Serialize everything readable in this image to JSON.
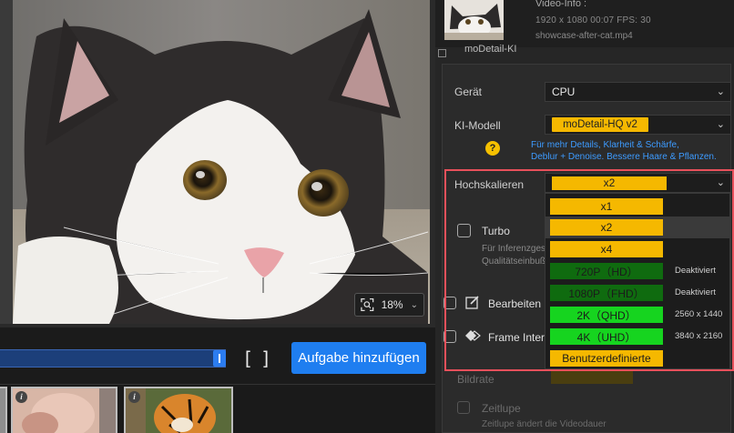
{
  "preview": {
    "zoom_value": "18%"
  },
  "timeline": {
    "bracket_in": "[",
    "bracket_out": "]",
    "add_task_label": "Aufgabe hinzufügen"
  },
  "thumbnails": [
    {
      "info": "i"
    },
    {
      "info": "i"
    }
  ],
  "video_info": {
    "title": "Video-Info :",
    "meta": "1920 x 1080  00:07  FPS: 30",
    "file": "showcase-after-cat.mp4"
  },
  "ai_section": {
    "title": "moDetail-KI",
    "device_label": "Gerät",
    "device_value": "CPU",
    "model_label": "KI-Modell",
    "model_value": "moDetail-HQ  v2",
    "model_desc_line1": "Für mehr Details, Klarheit & Schärfe,",
    "model_desc_line2": "Deblur + Denoise. Bessere Haare & Pflanzen.",
    "help_glyph": "?",
    "upscale_label": "Hochskalieren",
    "upscale_value": "x2",
    "upscale_options": [
      {
        "label": "x1",
        "note": "",
        "color": "#f5b800"
      },
      {
        "label": "x2",
        "note": "",
        "color": "#f5b800"
      },
      {
        "label": "x4",
        "note": "",
        "color": "#f5b800"
      },
      {
        "label": "720P（HD）",
        "note": "Deaktiviert",
        "color": "#0f6b0f"
      },
      {
        "label": "1080P（FHD）",
        "note": "Deaktiviert",
        "color": "#0f6b0f"
      },
      {
        "label": "2K（QHD）",
        "note": "2560 x 1440",
        "color": "#16d41f"
      },
      {
        "label": "4K（UHD）",
        "note": "3840 x 2160",
        "color": "#16d41f"
      },
      {
        "label": "Benutzerdefinierte",
        "note": "",
        "color": "#f5b800"
      }
    ],
    "turbo_label": "Turbo",
    "turbo_desc_line1": "Für Inferenzges",
    "turbo_desc_line2": "Qualitätseinbuß"
  },
  "edit_section": {
    "label": "Bearbeiten"
  },
  "frame_section": {
    "label": "Frame Interpo"
  },
  "framerate": {
    "label": "Bildrate"
  },
  "slowmo": {
    "label": "Zeitlupe",
    "desc": "Zeitlupe ändert die Videodauer"
  },
  "colors": {
    "accent_blue": "#1f7ef0",
    "highlight_frame": "#e8505b",
    "pill_yellow": "#f5b800",
    "link_blue": "#3d9bff"
  }
}
